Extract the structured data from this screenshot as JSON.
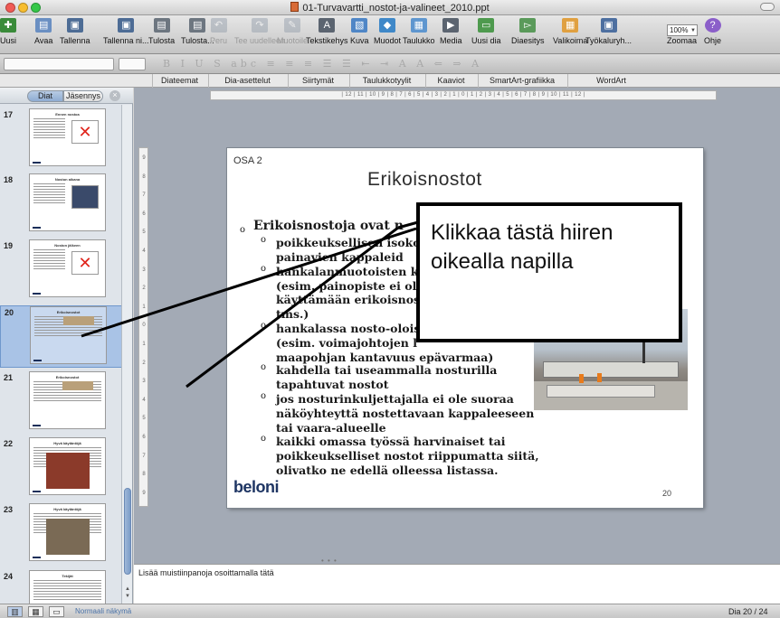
{
  "window": {
    "title": "01-Turvavartti_nostot-ja-valineet_2010.ppt"
  },
  "toolbar": {
    "items": [
      {
        "label": "Uusi",
        "icon": "new-document-icon",
        "color": "#3a8b3a"
      },
      {
        "label": "Avaa",
        "icon": "open-folder-icon",
        "color": "#6a8fc2"
      },
      {
        "label": "Tallenna",
        "icon": "save-disk-icon",
        "color": "#4d6c95"
      },
      {
        "label": "Tallenna ni...",
        "icon": "save-as-icon",
        "color": "#4d6c95"
      },
      {
        "label": "Tulosta",
        "icon": "print-icon",
        "color": "#6d7680"
      },
      {
        "label": "Tulosta...",
        "icon": "print-dialog-icon",
        "color": "#6d7680"
      },
      {
        "label": "Peru",
        "icon": "undo-icon",
        "color": "#8f9aa8",
        "disabled": true
      },
      {
        "label": "Tee uudelleen",
        "icon": "redo-icon",
        "color": "#8f9aa8",
        "disabled": true
      },
      {
        "label": "Muotoile",
        "icon": "format-brush-icon",
        "color": "#8f9aa8",
        "disabled": true
      },
      {
        "label": "Tekstikehys",
        "icon": "text-box-icon",
        "color": "#5b6470"
      },
      {
        "label": "Kuva",
        "icon": "picture-icon",
        "color": "#4f86c6"
      },
      {
        "label": "Muodot",
        "icon": "shapes-icon",
        "color": "#3f88c8"
      },
      {
        "label": "Taulukko",
        "icon": "table-icon",
        "color": "#5e96cf"
      },
      {
        "label": "Media",
        "icon": "media-icon",
        "color": "#5b6470"
      },
      {
        "label": "Uusi dia",
        "icon": "new-slide-icon",
        "color": "#4e9a4e"
      },
      {
        "label": "Diaesitys",
        "icon": "slideshow-icon",
        "color": "#5a9a5a"
      },
      {
        "label": "Valikoima",
        "icon": "gallery-icon",
        "color": "#e0a040"
      },
      {
        "label": "Työkaluryh...",
        "icon": "toolbox-icon",
        "color": "#4d6fa0"
      },
      {
        "label": "Zoomaa",
        "icon": "zoom-icon",
        "color": "#ffffff"
      },
      {
        "label": "Ohje",
        "icon": "help-icon",
        "color": "#8b5fc9"
      }
    ],
    "zoom_value": "100%"
  },
  "ribbon": {
    "tabs": [
      "Diateemat",
      "Dia-asettelut",
      "Siirtymät",
      "Taulukkotyylit",
      "Kaaviot",
      "SmartArt-grafiikka",
      "WordArt"
    ]
  },
  "panel": {
    "tab_slides": "Diat",
    "tab_outline": "Jäsennys"
  },
  "thumbnails": [
    {
      "num": "17",
      "title": "Ennen nostoa"
    },
    {
      "num": "18",
      "title": "Noston aikana"
    },
    {
      "num": "19",
      "title": "Noston jälkeen"
    },
    {
      "num": "20",
      "title": "Erikoisnostot",
      "selected": true
    },
    {
      "num": "21",
      "title": "Erikoisnostot"
    },
    {
      "num": "22",
      "title": "Hyvä käytäntöjä"
    },
    {
      "num": "23",
      "title": "Hyvä käytäntöjä"
    },
    {
      "num": "24",
      "title": "Tekijät"
    }
  ],
  "ruler": {
    "horizontal": "| 12 | 11 | 10 | 9 | 8 | 7 | 6 | 5 | 4 | 3 | 2 | 1 | 0 | 1 | 2 | 3 | 4 | 5 | 6 | 7 | 8 | 9 | 10 | 11 | 12 |",
    "vertical": [
      "9",
      "8",
      "7",
      "6",
      "5",
      "4",
      "3",
      "2",
      "1",
      "0",
      "1",
      "2",
      "3",
      "4",
      "5",
      "6",
      "7",
      "8",
      "9"
    ]
  },
  "slide": {
    "part_label": "OSA 2",
    "title": "Erikoisnostot",
    "bullet_main": "Erikoisnostoja ovat n",
    "sub_lines": [
      "poikkeuksellisen isoko",
      "painavien kappaleid",
      "hankalanmuotoisten k",
      "(esim. painopiste ei ol",
      "käyttämään erikoisnos",
      "tms.)",
      "hankalassa nosto-olois",
      "(esim. voimajohtojen l",
      "maapohjan kantavuus epävarmaa)",
      "kahdella tai useammalla nosturilla",
      "tapahtuvat nostot",
      "jos nosturinkuljettajalla ei ole suoraa",
      "näköyhteyttä nostettavaan kappaleeseen",
      "tai vaara-alueelle",
      "kaikki omassa työssä harvinaiset tai",
      "poikkeukselliset nostot riippumatta siitä,",
      "olivatko ne edellä olleessa listassa."
    ],
    "logo": "beloni",
    "page_number": "20"
  },
  "callout": {
    "text": "Klikkaa tästä hiiren oikealla napilla"
  },
  "notes": {
    "placeholder": "Lisää muistiinpanoja osoittamalla tätä"
  },
  "status": {
    "view_label": "Normaali näkymä",
    "page_indicator": "Dia 20 / 24"
  }
}
